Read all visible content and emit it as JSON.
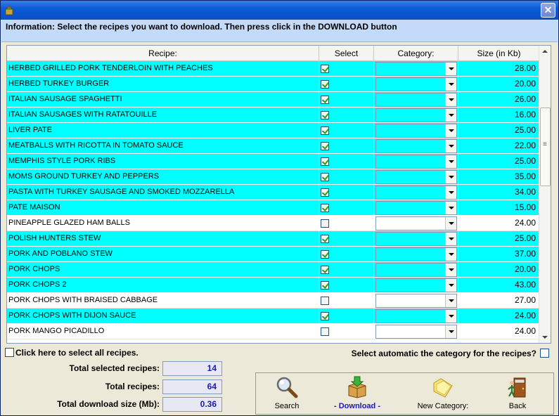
{
  "info": {
    "text": "Information: Select the recipes you want to download. Then press click in the DOWNLOAD button"
  },
  "grid": {
    "columns": {
      "recipe": "Recipe:",
      "select": "Select",
      "category": "Category:",
      "size": "Size (in Kb)"
    },
    "rows": [
      {
        "name": "HERBED GRILLED PORK TENDERLOIN WITH PEACHES",
        "checked": true,
        "size": "28.00"
      },
      {
        "name": "HERBED TURKEY BURGER",
        "checked": true,
        "size": "20.00"
      },
      {
        "name": "ITALIAN SAUSAGE SPAGHETTI",
        "checked": true,
        "size": "26.00"
      },
      {
        "name": "ITALIAN SAUSAGES WITH RATATOUILLE",
        "checked": true,
        "size": "16.00"
      },
      {
        "name": "LIVER PATE",
        "checked": true,
        "size": "25.00"
      },
      {
        "name": "MEATBALLS WITH RICOTTA IN TOMATO SAUCE",
        "checked": true,
        "size": "22.00"
      },
      {
        "name": "MEMPHIS STYLE PORK RIBS",
        "checked": true,
        "size": "25.00"
      },
      {
        "name": "MOMS GROUND TURKEY AND PEPPERS",
        "checked": true,
        "size": "35.00"
      },
      {
        "name": "PASTA WITH TURKEY SAUSAGE AND SMOKED MOZZARELLA",
        "checked": true,
        "size": "34.00"
      },
      {
        "name": "PATE MAISON",
        "checked": true,
        "size": "15.00"
      },
      {
        "name": "PINEAPPLE GLAZED HAM BALLS",
        "checked": false,
        "size": "24.00"
      },
      {
        "name": "POLISH HUNTERS STEW",
        "checked": true,
        "size": "25.00"
      },
      {
        "name": "PORK AND POBLANO STEW",
        "checked": true,
        "size": "37.00"
      },
      {
        "name": "PORK CHOPS",
        "checked": true,
        "size": "20.00"
      },
      {
        "name": "PORK CHOPS 2",
        "checked": true,
        "size": "43.00"
      },
      {
        "name": "PORK CHOPS WITH BRAISED CABBAGE",
        "checked": false,
        "size": "27.00"
      },
      {
        "name": "PORK CHOPS WITH DIJON SAUCE",
        "checked": true,
        "size": "24.00"
      },
      {
        "name": "PORK MANGO PICADILLO",
        "checked": false,
        "size": "24.00"
      }
    ]
  },
  "controls": {
    "select_all_label": "Click here to select all recipes.",
    "auto_category_label": "Select automatic the category for the recipes?"
  },
  "stats": {
    "total_selected_label": "Total selected recipes:",
    "total_selected_value": "14",
    "total_recipes_label": "Total recipes:",
    "total_recipes_value": "64",
    "total_size_label": "Total download size (Mb):",
    "total_size_value": "0.36"
  },
  "toolbar": {
    "search_label": "Search",
    "download_label": "- Download -",
    "new_category_label": "New Category:",
    "back_label": "Back"
  },
  "colors": {
    "selected_row": "#00ffff",
    "info_bar": "#c3daf9",
    "window_bg": "#ece9d8"
  }
}
